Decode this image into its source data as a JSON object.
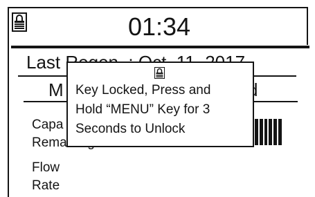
{
  "header": {
    "icon": "lock-icon",
    "time": "01:34"
  },
  "regen": {
    "text": "Last Regen. : Oct. 11, 2017"
  },
  "mode": {
    "left": "M",
    "right": "d"
  },
  "metrics": {
    "capacity_label": "Capa",
    "remaining_label": "Remaining",
    "flow_label": "Flow",
    "rate_label": "Rate"
  },
  "popup": {
    "icon": "lock-icon",
    "line1": "Key Locked, Press and",
    "line2": "Hold “MENU” Key for 3",
    "line3": "Seconds to Unlock"
  }
}
